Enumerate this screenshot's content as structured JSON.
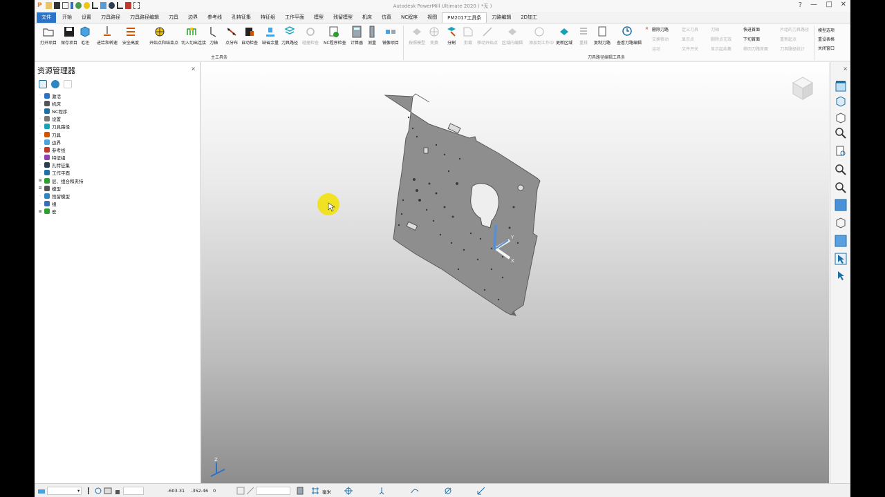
{
  "window": {
    "title": "Autodesk PowerMill Ultimate 2020   ( *无 )",
    "help_icon": "?",
    "minimize": "—",
    "maximize": "□",
    "close": "✕"
  },
  "tabs": {
    "file": "文件",
    "items": [
      "开始",
      "设置",
      "刀具路径",
      "刀具路径编辑",
      "刀具",
      "边界",
      "参考线",
      "孔特征集",
      "特征组",
      "工作平面",
      "模型",
      "残留模型",
      "机床",
      "仿真",
      "NC程序",
      "视图",
      "PM2017工具条",
      "刀路编辑",
      "2D加工"
    ],
    "active": "PM2017工具条"
  },
  "ribbon": {
    "main_group_label": "主工具条",
    "edit_group_label": "刀具路径编辑工具条",
    "main_buttons": [
      "打开项目",
      "保存项目",
      "毛坯",
      "进给和转速",
      "安全高度",
      "开始点和结束点",
      "切入切出连接",
      "刀轴",
      "点分布",
      "自动检查",
      "缺省余量",
      "刀具路径",
      "碰撞检查",
      "NC程序检查",
      "计算器",
      "测量",
      "镜像项目"
    ],
    "edit_buttons": [
      "按照模型",
      "变换",
      "分割",
      "剪裁",
      "移动开始点",
      "区域内编辑",
      "添加到工作中",
      "更新区域",
      "重排",
      "复制刀路",
      "查看刀路编辑"
    ],
    "edit_small_col1": [
      "删除刀路",
      "交换移动",
      "运动"
    ],
    "edit_small_col2": [
      "定义刀具",
      "显示点",
      "文件开关"
    ],
    "edit_small_col3": [
      "刀轴",
      "删除点无效",
      "显示起始集"
    ],
    "edit_small_col4": [
      "快进首面",
      "下切首面",
      "移回刀路首面"
    ],
    "edit_small_col5": [
      "片组的刀具路径",
      "重新起点",
      "刀具路径统计"
    ],
    "right_links": [
      "模型选项",
      "重设表格",
      "关闭窗口"
    ]
  },
  "explorer": {
    "title": "资源管理器",
    "close": "×",
    "tree": [
      {
        "label": "激活",
        "expandable": false,
        "icon": "active-icon"
      },
      {
        "label": "机床",
        "expandable": false,
        "icon": "machine-icon"
      },
      {
        "label": "NC程序",
        "expandable": false,
        "icon": "nc-program-icon"
      },
      {
        "label": "设置",
        "expandable": false,
        "icon": "setup-icon"
      },
      {
        "label": "刀具路径",
        "expandable": false,
        "icon": "toolpath-icon"
      },
      {
        "label": "刀具",
        "expandable": false,
        "icon": "tool-icon"
      },
      {
        "label": "边界",
        "expandable": false,
        "icon": "boundary-icon"
      },
      {
        "label": "参考线",
        "expandable": false,
        "icon": "pattern-icon"
      },
      {
        "label": "特征组",
        "expandable": false,
        "icon": "featureset-icon"
      },
      {
        "label": "孔特征集",
        "expandable": false,
        "icon": "hole-featureset-icon"
      },
      {
        "label": "工作平面",
        "expandable": false,
        "icon": "workplane-icon"
      },
      {
        "label": "层、组合和夹持",
        "expandable": true,
        "icon": "levels-icon"
      },
      {
        "label": "模型",
        "expandable": true,
        "icon": "model-icon"
      },
      {
        "label": "残留模型",
        "expandable": false,
        "icon": "stock-model-icon"
      },
      {
        "label": "组",
        "expandable": false,
        "icon": "group-icon"
      },
      {
        "label": "宏",
        "expandable": true,
        "icon": "macro-icon"
      }
    ]
  },
  "viewport": {
    "axis_labels": {
      "y": "Y",
      "x": "X",
      "z": "Z"
    }
  },
  "status": {
    "coord_x": "-603.31",
    "coord_y": "-352.46",
    "coord_z": "0",
    "units": "毫米"
  },
  "colors": {
    "accent_blue": "#2b73c6",
    "cursor_highlight": "#f2e200",
    "part_gray": "#8c8c8c"
  }
}
